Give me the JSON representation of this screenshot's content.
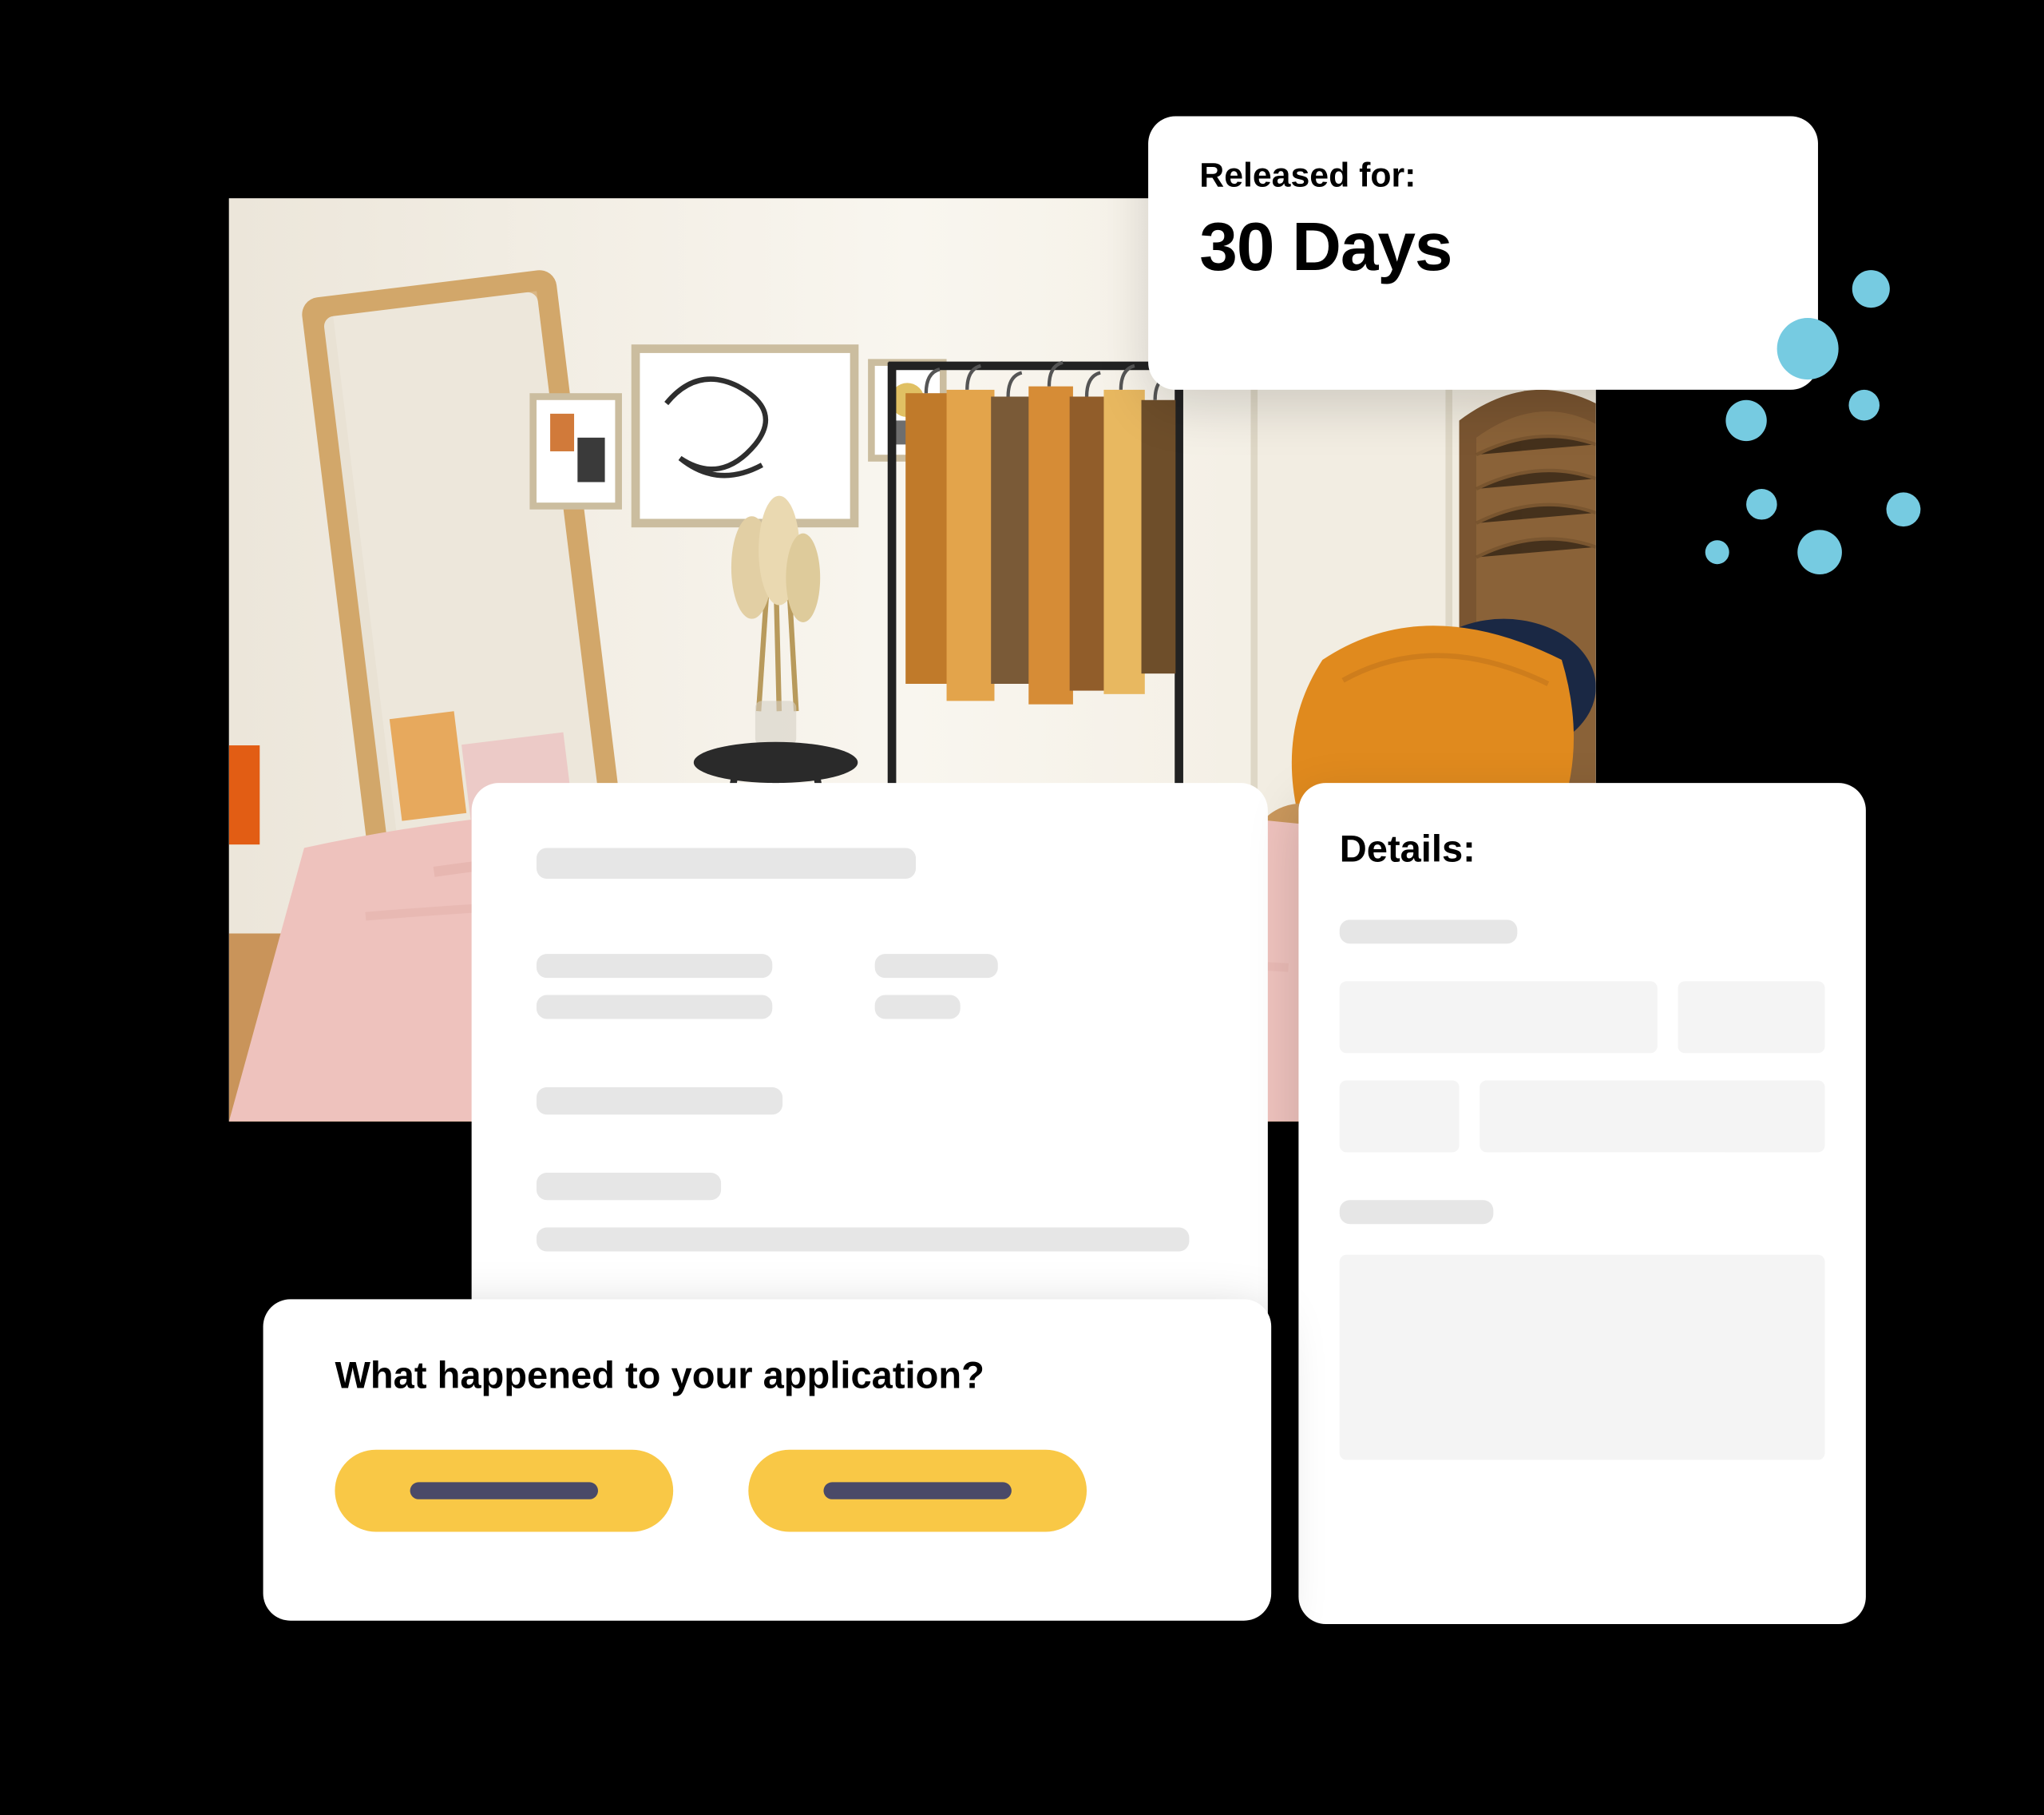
{
  "released": {
    "label": "Released for:",
    "value": "30 Days"
  },
  "details": {
    "title": "Details:"
  },
  "question": {
    "title": "What happened to your application?"
  },
  "colors": {
    "accent": "#f9c846",
    "bubble": "#76cbe1",
    "skeleton": "#e6e6e6",
    "field": "#f4f4f4",
    "btn_line": "#4a4a68"
  }
}
